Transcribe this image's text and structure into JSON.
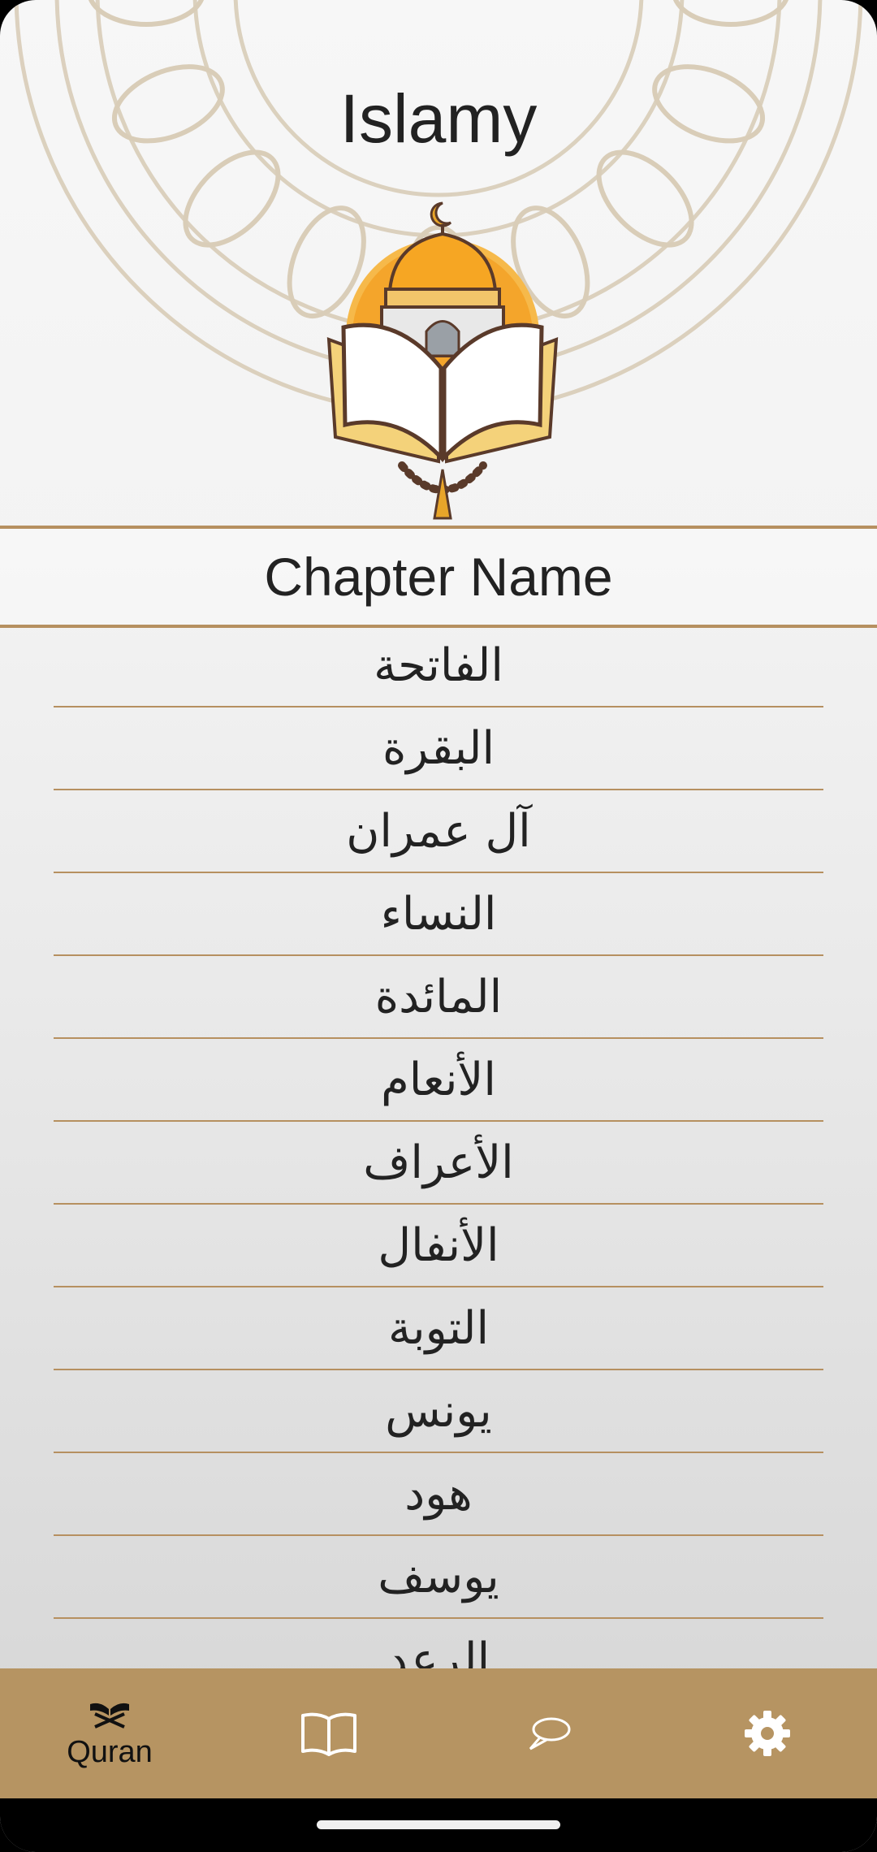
{
  "app": {
    "title": "Islamy"
  },
  "table": {
    "header": "Chapter Name"
  },
  "chapters": [
    "الفاتحة",
    "البقرة",
    "آل عمران",
    "النساء",
    "المائدة",
    "الأنعام",
    "الأعراف",
    "الأنفال",
    "التوبة",
    "يونس",
    "هود",
    "يوسف",
    "الرعد"
  ],
  "nav": {
    "items": [
      {
        "icon": "quran-icon",
        "label": "Quran",
        "active": true
      },
      {
        "icon": "book-icon",
        "label": "",
        "active": false
      },
      {
        "icon": "chat-bubble-icon",
        "label": "",
        "active": false
      },
      {
        "icon": "settings-icon",
        "label": "",
        "active": false
      }
    ]
  },
  "colors": {
    "accent": "#B69462",
    "divider": "#B69060",
    "text": "#222222",
    "active_icon": "#111111",
    "inactive_icon": "#FFFFFF"
  }
}
